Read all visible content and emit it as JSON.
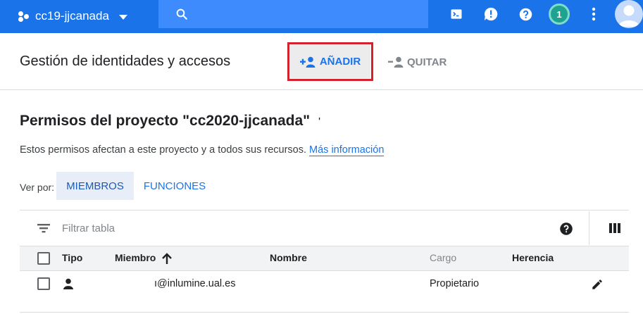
{
  "topbar": {
    "project_name": "cc19-jjcanada",
    "search_placeholder": "",
    "notification_count": "1",
    "icons": [
      "project-dots-icon",
      "dropdown-caret-icon",
      "search-icon",
      "cloud-shell-icon",
      "feedback-icon",
      "help-icon",
      "more-vert-icon",
      "account-icon"
    ]
  },
  "header": {
    "title": "Gestión de identidades y accesos",
    "add_label": "AÑADIR",
    "remove_label": "QUITAR"
  },
  "section": {
    "title": "Permisos del proyecto \"cc2020-jjcanada\"",
    "title_tail": "'",
    "description": "Estos permisos afectan a este proyecto y a todos sus recursos.",
    "more_info_link": "Más información",
    "view_by_label": "Ver por:",
    "tabs": [
      {
        "label": "MIEMBROS",
        "active": true
      },
      {
        "label": "FUNCIONES",
        "active": false
      }
    ]
  },
  "table": {
    "filter_placeholder": "Filtrar tabla",
    "columns": [
      "Tipo",
      "Miembro",
      "Nombre",
      "Cargo",
      "Herencia"
    ],
    "rows": [
      {
        "member": "@inlumine.ual.es",
        "member_prefix": "ı",
        "name": "",
        "role": "Propietario",
        "inheritance": ""
      }
    ]
  },
  "colors": {
    "topbar": "#1a73e8",
    "accent": "#1a73e8",
    "highlight_frame": "#d5222a",
    "badge": "#1fa390"
  }
}
